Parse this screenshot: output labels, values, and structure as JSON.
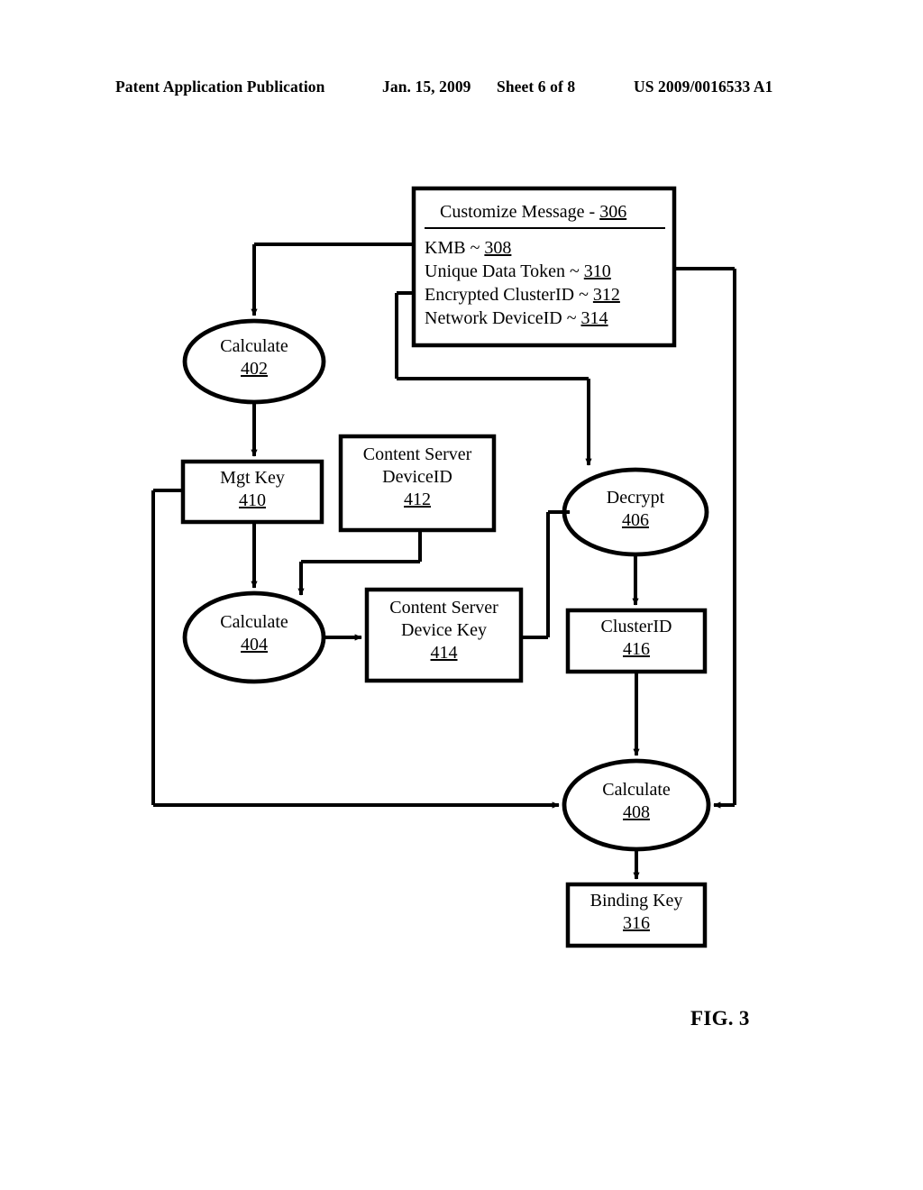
{
  "header": {
    "publication": "Patent Application Publication",
    "date": "Jan. 15, 2009",
    "sheet": "Sheet 6 of 8",
    "patent_number": "US 2009/0016533 A1"
  },
  "figure": {
    "caption": "FIG. 3",
    "customize_message": {
      "title_text": "Customize Message - ",
      "title_ref": "306",
      "lines": [
        {
          "label": "KMB ~ ",
          "ref": "308"
        },
        {
          "label": "Unique Data Token ~ ",
          "ref": "310"
        },
        {
          "label": "Encrypted ClusterID ~ ",
          "ref": "312"
        },
        {
          "label": "Network DeviceID ~ ",
          "ref": "314"
        }
      ]
    },
    "nodes": {
      "calculate_402": {
        "label": "Calculate",
        "ref": "402",
        "shape": "ellipse"
      },
      "calculate_404": {
        "label": "Calculate",
        "ref": "404",
        "shape": "ellipse"
      },
      "decrypt_406": {
        "label": "Decrypt",
        "ref": "406",
        "shape": "ellipse"
      },
      "calculate_408": {
        "label": "Calculate",
        "ref": "408",
        "shape": "ellipse"
      },
      "mgt_key_410": {
        "label": "Mgt Key",
        "ref": "410",
        "shape": "box"
      },
      "cs_deviceid_412": {
        "label": "Content Server\nDeviceID",
        "line1": "Content Server",
        "line2": "DeviceID",
        "ref": "412",
        "shape": "box"
      },
      "cs_devkey_414": {
        "label": "Content Server\nDevice Key",
        "line1": "Content Server",
        "line2": "Device Key",
        "ref": "414",
        "shape": "box"
      },
      "clusterid_416": {
        "label": "ClusterID",
        "ref": "416",
        "shape": "box"
      },
      "binding_key_316": {
        "label": "Binding Key",
        "ref": "316",
        "shape": "box"
      }
    },
    "colors": {
      "stroke": "#000000",
      "background": "#ffffff"
    }
  }
}
